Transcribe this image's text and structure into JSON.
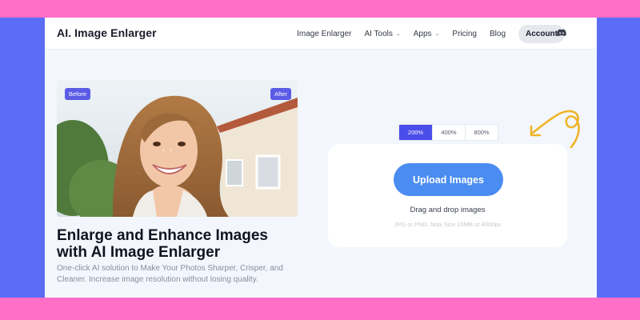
{
  "brand": {
    "logo_text": "AI. Image Enlarger",
    "frame_color": "#ff6ec7",
    "band_color": "#5b6cf5",
    "accent_color": "#4b4dea",
    "upload_color": "#4a8cf0"
  },
  "nav": {
    "items": [
      {
        "label": "Image Enlarger",
        "has_dropdown": false
      },
      {
        "label": "AI Tools",
        "has_dropdown": true
      },
      {
        "label": "Apps",
        "has_dropdown": true
      },
      {
        "label": "Pricing",
        "has_dropdown": false
      },
      {
        "label": "Blog",
        "has_dropdown": false
      }
    ],
    "account_label": "Account",
    "discord_icon": "discord-icon"
  },
  "hero": {
    "before_label": "Before",
    "after_label": "After",
    "headline_line1": "Enlarge and Enhance Images",
    "headline_line2": "with AI Image Enlarger",
    "subtext": "One-click AI solution to Make Your Photos Sharper, Crisper, and Cleaner. Increase image resolution without losing quality."
  },
  "upload": {
    "zoom_options": [
      "200%",
      "400%",
      "800%"
    ],
    "selected_zoom": "200%",
    "button_label": "Upload Images",
    "drag_text": "Drag and drop images",
    "format_text": "JPG or PNG. Max Size 10MB or 4000px"
  }
}
